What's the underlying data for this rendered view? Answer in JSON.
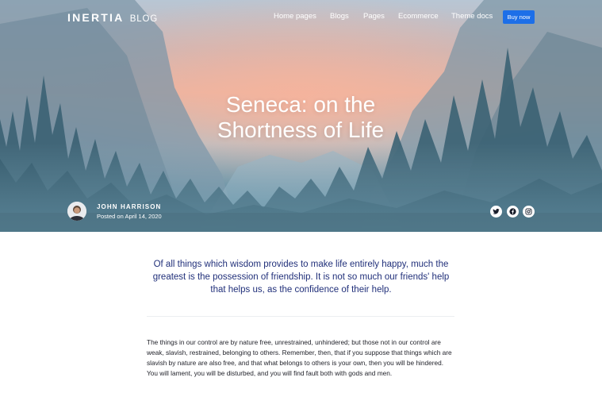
{
  "nav": {
    "logo_brand": "INERTIA",
    "logo_sub": "BLOG",
    "items": [
      {
        "label": "Home pages"
      },
      {
        "label": "Blogs"
      },
      {
        "label": "Pages"
      },
      {
        "label": "Ecommerce"
      },
      {
        "label": "Theme docs"
      }
    ],
    "buy_label": "Buy now",
    "buy_color": "#1d6fe8"
  },
  "hero": {
    "title": "Seneca: on the Shortness of Life",
    "author_name": "JOHN HARRISON",
    "post_date": "Posted on April 14, 2020",
    "social_icons": [
      "twitter-icon",
      "facebook-icon",
      "instagram-icon"
    ]
  },
  "article": {
    "lead_quote": "Of all things which wisdom provides to make life entirely happy, much the greatest is the possession of friendship. It is not so much our friends' help that helps us, as the confidence of their help.",
    "paragraph": "The things in our control are by nature free, unrestrained, unhindered; but those not in our control are weak, slavish, restrained, belonging to others. Remember, then, that if you suppose that things which are slavish by nature are also free, and that what belongs to others is your own, then you will be hindered. You will lament, you will be disturbed, and you will find fault both with gods and men.",
    "quote_color": "#21307a"
  }
}
